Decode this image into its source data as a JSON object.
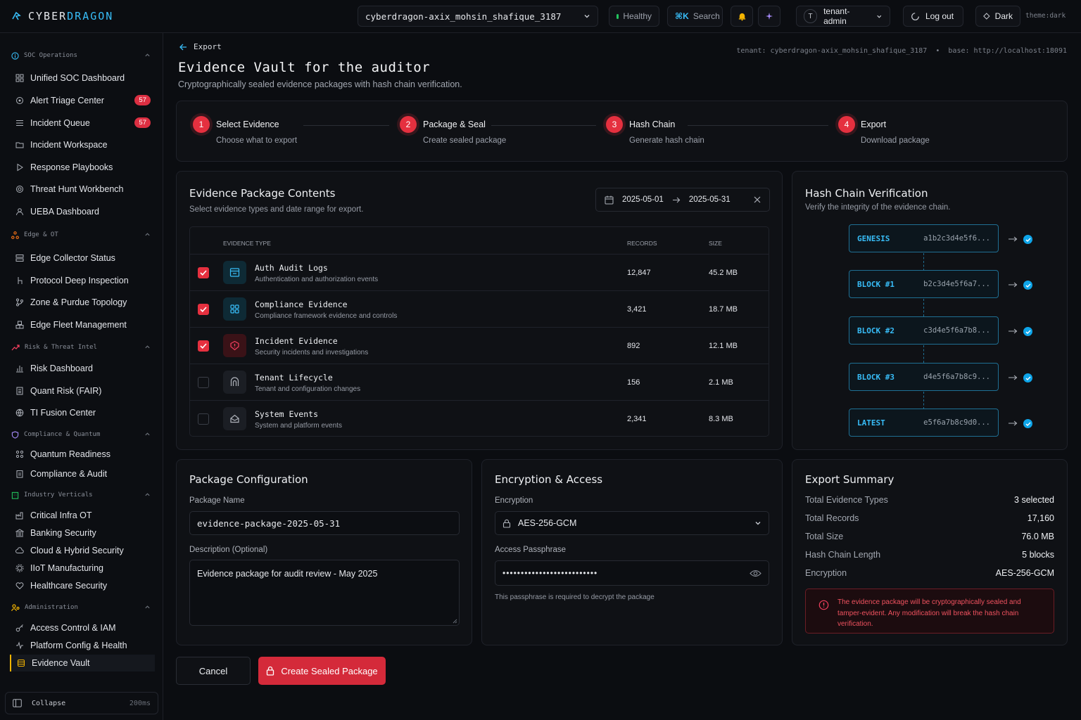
{
  "brand": {
    "part1": "CYBER",
    "part2": "DRAGON"
  },
  "topbar": {
    "tenant_select": "cyberdragon-axix_mohsin_shafique_3187",
    "health": "Healthy",
    "search_shortcut": "⌘K",
    "search_label": "Search",
    "user_initial": "T",
    "user": "tenant-admin",
    "logout": "Log out",
    "theme_toggle": "Dark",
    "theme_tag": "theme:dark"
  },
  "sidebar": {
    "sections": [
      {
        "label": "SOC Operations",
        "items": [
          "Unified SOC Dashboard",
          "Alert Triage Center",
          "Incident Queue",
          "Incident Workspace",
          "Response Playbooks",
          "Threat Hunt Workbench",
          "UEBA Dashboard"
        ]
      },
      {
        "label": "Edge & OT",
        "items": [
          "Edge Collector Status",
          "Protocol Deep Inspection",
          "Zone & Purdue Topology",
          "Edge Fleet Management"
        ]
      },
      {
        "label": "Risk & Threat Intel",
        "items": [
          "Risk Dashboard",
          "Quant Risk (FAIR)",
          "TI Fusion Center"
        ]
      },
      {
        "label": "Compliance & Quantum",
        "items": [
          "Quantum Readiness",
          "Compliance & Audit"
        ]
      },
      {
        "label": "Industry Verticals",
        "items": [
          "Critical Infra OT",
          "Banking Security",
          "Cloud & Hybrid Security",
          "IIoT Manufacturing",
          "Healthcare Security"
        ]
      },
      {
        "label": "Administration",
        "items": [
          "Access Control & IAM",
          "Platform Config & Health",
          "Evidence Vault"
        ]
      }
    ],
    "badges": {
      "alert_triage": "57",
      "incident_queue": "57"
    },
    "collapse_label": "Collapse",
    "collapse_timing": "200ms"
  },
  "header": {
    "back_label": "Export",
    "tenant_info": "tenant: cyberdragon-axix_mohsin_shafique_3187  •  base: http://localhost:18091",
    "title": "Evidence Vault for the auditor",
    "subtitle": "Cryptographically sealed evidence packages with hash chain verification."
  },
  "steps": [
    {
      "num": "1",
      "title": "Select Evidence",
      "desc": "Choose what to export"
    },
    {
      "num": "2",
      "title": "Package & Seal",
      "desc": "Create sealed package"
    },
    {
      "num": "3",
      "title": "Hash Chain",
      "desc": "Generate hash chain"
    },
    {
      "num": "4",
      "title": "Export",
      "desc": "Download package"
    }
  ],
  "contents": {
    "title": "Evidence Package Contents",
    "subtitle": "Select evidence types and date range for export.",
    "date_from": "2025-05-01",
    "date_to": "2025-05-31",
    "columns": {
      "type": "EVIDENCE TYPE",
      "records": "RECORDS",
      "size": "SIZE"
    },
    "rows": [
      {
        "name": "Auth Audit Logs",
        "desc": "Authentication and authorization events",
        "records": "12,847",
        "size": "45.2 MB",
        "checked": true
      },
      {
        "name": "Compliance Evidence",
        "desc": "Compliance framework evidence and controls",
        "records": "3,421",
        "size": "18.7 MB",
        "checked": true
      },
      {
        "name": "Incident Evidence",
        "desc": "Security incidents and investigations",
        "records": "892",
        "size": "12.1 MB",
        "checked": true
      },
      {
        "name": "Tenant Lifecycle",
        "desc": "Tenant and configuration changes",
        "records": "156",
        "size": "2.1 MB",
        "checked": false
      },
      {
        "name": "System Events",
        "desc": "System and platform events",
        "records": "2,341",
        "size": "8.3 MB",
        "checked": false
      }
    ]
  },
  "hash_chain": {
    "title": "Hash Chain Verification",
    "subtitle": "Verify the integrity of the evidence chain.",
    "blocks": [
      {
        "label": "GENESIS",
        "hash": "a1b2c3d4e5f6..."
      },
      {
        "label": "BLOCK #1",
        "hash": "b2c3d4e5f6a7..."
      },
      {
        "label": "BLOCK #2",
        "hash": "c3d4e5f6a7b8..."
      },
      {
        "label": "BLOCK #3",
        "hash": "d4e5f6a7b8c9..."
      },
      {
        "label": "LATEST",
        "hash": "e5f6a7b8c9d0..."
      }
    ]
  },
  "config": {
    "title": "Package Configuration",
    "name_label": "Package Name",
    "name_value": "evidence-package-2025-05-31",
    "desc_label": "Description (Optional)",
    "desc_value": "Evidence package for audit review - May 2025"
  },
  "encryption": {
    "title": "Encryption & Access",
    "enc_label": "Encryption",
    "enc_value": "AES-256-GCM",
    "pass_label": "Access Passphrase",
    "pass_value": "••••••••••••••••••••••••••",
    "hint": "This passphrase is required to decrypt the package"
  },
  "summary": {
    "title": "Export Summary",
    "rows": [
      {
        "k": "Total Evidence Types",
        "v": "3 selected"
      },
      {
        "k": "Total Records",
        "v": "17,160"
      },
      {
        "k": "Total Size",
        "v": "76.0 MB"
      },
      {
        "k": "Hash Chain Length",
        "v": "5 blocks"
      },
      {
        "k": "Encryption",
        "v": "AES-256-GCM"
      }
    ],
    "warning": "The evidence package will be cryptographically sealed and tamper-evident. Any modification will break the hash chain verification."
  },
  "actions": {
    "cancel": "Cancel",
    "create": "Create Sealed Package"
  },
  "colors": {
    "accent": "#e5303f",
    "cyan": "#38bdf8",
    "bg": "#0b0d11",
    "healthy": "#22c55e"
  }
}
